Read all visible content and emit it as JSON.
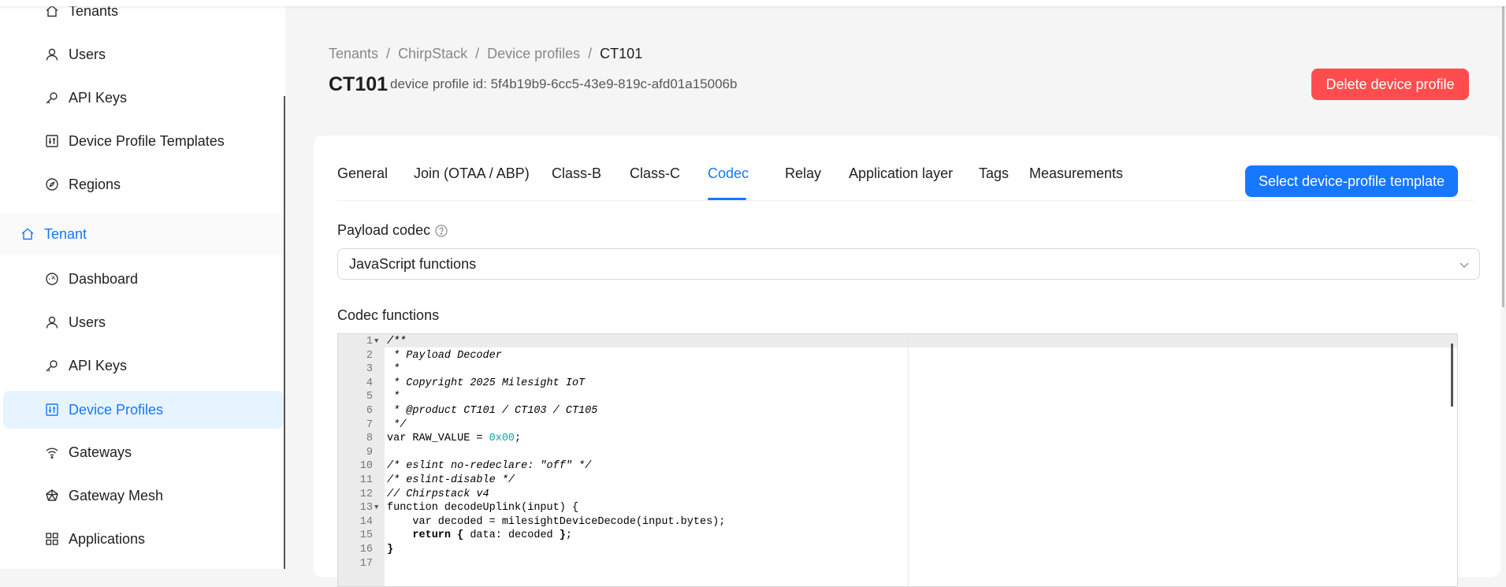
{
  "sidebar": {
    "items": [
      {
        "label": "Tenants",
        "icon": "home-icon"
      },
      {
        "label": "Users",
        "icon": "user-icon"
      },
      {
        "label": "API Keys",
        "icon": "key-icon"
      },
      {
        "label": "Device Profile Templates",
        "icon": "sliders-icon"
      },
      {
        "label": "Regions",
        "icon": "compass-icon"
      },
      {
        "label": "Tenant",
        "icon": "home-icon"
      },
      {
        "label": "Dashboard",
        "icon": "dashboard-icon"
      },
      {
        "label": "Users",
        "icon": "user-icon"
      },
      {
        "label": "API Keys",
        "icon": "key-icon"
      },
      {
        "label": "Device Profiles",
        "icon": "sliders-icon"
      },
      {
        "label": "Gateways",
        "icon": "wifi-icon"
      },
      {
        "label": "Gateway Mesh",
        "icon": "mesh-icon"
      },
      {
        "label": "Applications",
        "icon": "apps-icon"
      }
    ]
  },
  "breadcrumb": [
    "Tenants",
    "ChirpStack",
    "Device profiles",
    "CT101"
  ],
  "header": {
    "title": "CT101",
    "subtitle": "device profile id: 5f4b19b9-6cc5-43e9-819c-afd01a15006b",
    "delete_label": "Delete device profile"
  },
  "tabs": [
    "General",
    "Join (OTAA / ABP)",
    "Class-B",
    "Class-C",
    "Codec",
    "Relay",
    "Application layer",
    "Tags",
    "Measurements"
  ],
  "active_tab": "Codec",
  "select_template_label": "Select device-profile template",
  "payload_codec": {
    "label": "Payload codec",
    "value": "JavaScript functions"
  },
  "codec_functions": {
    "label": "Codec functions",
    "lines": [
      "/**",
      " * Payload Decoder",
      " *",
      " * Copyright 2025 Milesight IoT",
      " *",
      " * @product CT101 / CT103 / CT105",
      " */",
      "var RAW_VALUE = 0x00;",
      "",
      "/* eslint no-redeclare: \"off\" */",
      "/* eslint-disable */",
      "// Chirpstack v4",
      "function decodeUplink(input) {",
      "    var decoded = milesightDeviceDecode(input.bytes);",
      "    return { data: decoded };",
      "}",
      ""
    ]
  },
  "colors": {
    "primary": "#1677ff",
    "danger": "#ff4d4f",
    "active_bg": "#e6f4ff"
  }
}
